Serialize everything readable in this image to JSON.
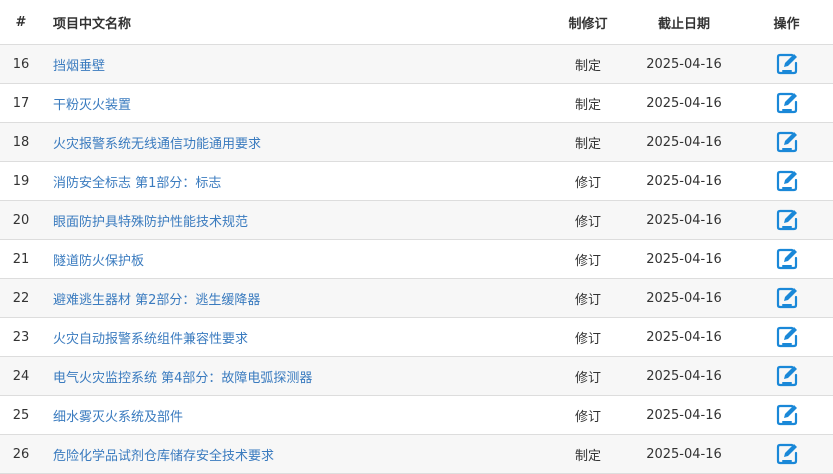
{
  "headers": {
    "num": "#",
    "name": "项目中文名称",
    "type": "制修订",
    "date": "截止日期",
    "op": "操作"
  },
  "colors": {
    "link": "#3a7bbf",
    "icon": "#1a88d8",
    "stripe": "#f7f7f7"
  },
  "rows": [
    {
      "num": "16",
      "name": "挡烟垂壁",
      "type": "制定",
      "date": "2025-04-16",
      "icon": "edit-icon"
    },
    {
      "num": "17",
      "name": "干粉灭火装置",
      "type": "制定",
      "date": "2025-04-16",
      "icon": "edit-icon"
    },
    {
      "num": "18",
      "name": "火灾报警系统无线通信功能通用要求",
      "type": "制定",
      "date": "2025-04-16",
      "icon": "edit-icon"
    },
    {
      "num": "19",
      "name": "消防安全标志 第1部分：标志",
      "type": "修订",
      "date": "2025-04-16",
      "icon": "edit-icon"
    },
    {
      "num": "20",
      "name": "眼面防护具特殊防护性能技术规范",
      "type": "修订",
      "date": "2025-04-16",
      "icon": "edit-icon"
    },
    {
      "num": "21",
      "name": "隧道防火保护板",
      "type": "修订",
      "date": "2025-04-16",
      "icon": "edit-icon"
    },
    {
      "num": "22",
      "name": "避难逃生器材 第2部分：逃生缓降器",
      "type": "修订",
      "date": "2025-04-16",
      "icon": "edit-icon"
    },
    {
      "num": "23",
      "name": "火灾自动报警系统组件兼容性要求",
      "type": "修订",
      "date": "2025-04-16",
      "icon": "edit-icon"
    },
    {
      "num": "24",
      "name": "电气火灾监控系统 第4部分：故障电弧探测器",
      "type": "修订",
      "date": "2025-04-16",
      "icon": "edit-icon"
    },
    {
      "num": "25",
      "name": "细水雾灭火系统及部件",
      "type": "修订",
      "date": "2025-04-16",
      "icon": "edit-icon"
    },
    {
      "num": "26",
      "name": "危险化学品试剂仓库储存安全技术要求",
      "type": "制定",
      "date": "2025-04-16",
      "icon": "edit-icon"
    }
  ]
}
